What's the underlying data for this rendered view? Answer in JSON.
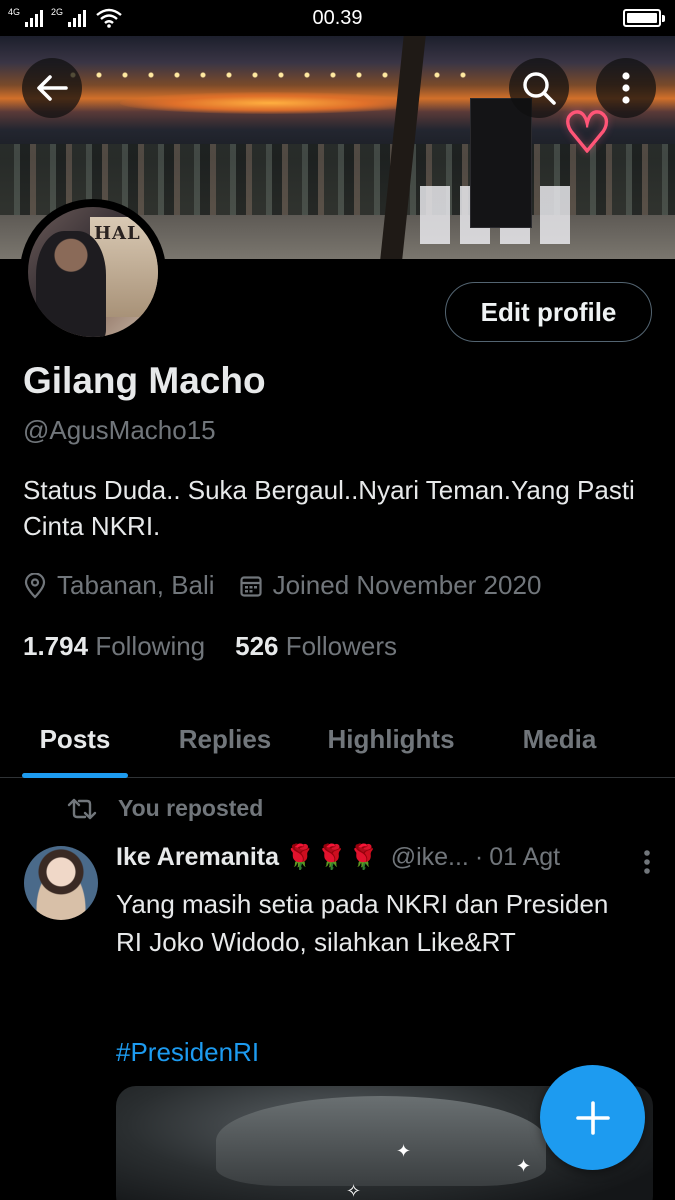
{
  "status_bar": {
    "network_1": "4G",
    "network_2": "2G",
    "time": "00.39",
    "battery_level": 1.0
  },
  "header": {
    "back_icon": "arrow-left-icon",
    "search_icon": "search-icon",
    "more_icon": "more-vertical-icon"
  },
  "profile": {
    "avatar_sign_text": "HAL",
    "edit_label": "Edit profile",
    "name": "Gilang Macho",
    "handle": "@AgusMacho15",
    "bio": "Status Duda.. Suka Bergaul..Nyari Teman.Yang Pasti Cinta NKRI.",
    "location": "Tabanan, Bali",
    "joined": "Joined November 2020",
    "following_count": "1.794",
    "following_label": "Following",
    "followers_count": "526",
    "followers_label": "Followers"
  },
  "tabs": [
    {
      "label": "Posts",
      "active": true
    },
    {
      "label": "Replies",
      "active": false
    },
    {
      "label": "Highlights",
      "active": false
    },
    {
      "label": "Media",
      "active": false
    }
  ],
  "post": {
    "repost_label": "You reposted",
    "author_name": "Ike Aremanita",
    "author_emoji": "🌹🌹🌹",
    "author_handle": "@ike...",
    "date": "01 Agt",
    "text": "Yang masih setia pada NKRI dan Presiden RI Joko Widodo, silahkan Like&RT",
    "hashtag": "#PresidenRI"
  },
  "fab": {
    "icon": "plus-icon"
  },
  "colors": {
    "background": "#000000",
    "accent": "#1d9bf0",
    "text_primary": "#e7e9ea",
    "text_secondary": "#71767b",
    "border": "#2f3336"
  }
}
